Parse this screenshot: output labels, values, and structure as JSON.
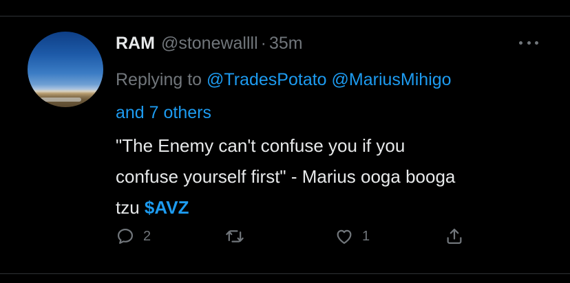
{
  "tweet": {
    "author": {
      "display_name": "RAM",
      "handle": "@stonewallll",
      "separator": "·",
      "time": "35m"
    },
    "reply": {
      "prefix": "Replying to",
      "mention_1": "@TradesPotato",
      "mention_2": "@MariusMihigo",
      "others": "and 7 others"
    },
    "text": {
      "line_1": "\"The Enemy can't confuse you if you",
      "line_2": "confuse yourself first\" - Marius ooga booga",
      "line_3_prefix": "tzu",
      "cashtag": "$AVZ"
    },
    "actions": {
      "reply_count": "2",
      "retweet_count": "",
      "like_count": "1"
    },
    "icons": {
      "more": "more-horizontal-icon",
      "reply": "reply-bubble-icon",
      "retweet": "retweet-icon",
      "like": "heart-icon",
      "share": "share-icon"
    },
    "colors": {
      "background": "#000000",
      "text_primary": "#e7e9ea",
      "text_secondary": "#71767b",
      "accent": "#1d9bf0",
      "divider": "#2f3336"
    }
  }
}
